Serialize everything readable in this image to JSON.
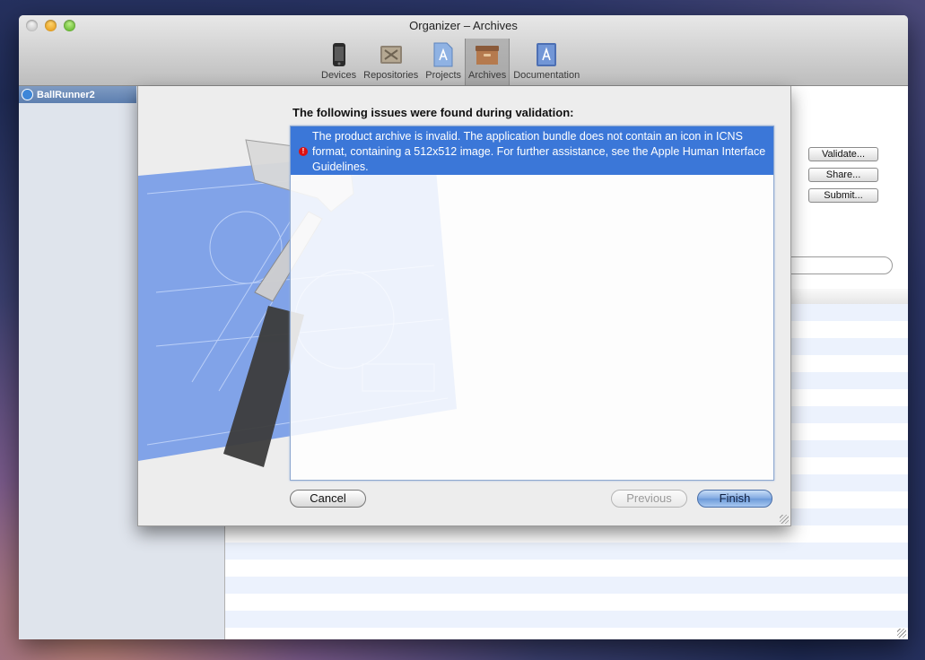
{
  "window": {
    "title": "Organizer – Archives"
  },
  "toolbar": {
    "items": [
      {
        "label": "Devices",
        "icon": "device-icon"
      },
      {
        "label": "Repositories",
        "icon": "repository-icon"
      },
      {
        "label": "Projects",
        "icon": "projects-icon"
      },
      {
        "label": "Archives",
        "icon": "archives-icon",
        "selected": true
      },
      {
        "label": "Documentation",
        "icon": "documentation-icon"
      }
    ]
  },
  "sidebar": {
    "items": [
      {
        "label": "BallRunner2",
        "icon": "app-icon",
        "selected": true
      }
    ]
  },
  "actions": {
    "validate": "Validate...",
    "share": "Share...",
    "submit": "Submit..."
  },
  "sheet": {
    "heading": "The following issues were found during validation:",
    "issues": [
      {
        "severity": "error",
        "icon": "error-icon",
        "text": "The product archive is invalid. The application bundle does not contain an icon in ICNS format, containing a 512x512 image. For further assistance, see the Apple Human Interface Guidelines."
      }
    ],
    "buttons": {
      "cancel": "Cancel",
      "previous": "Previous",
      "finish": "Finish"
    }
  },
  "colors": {
    "selection_blue": "#3b77d8",
    "error_red": "#dd1111",
    "sidebar_bg": "#dfe4ec"
  }
}
